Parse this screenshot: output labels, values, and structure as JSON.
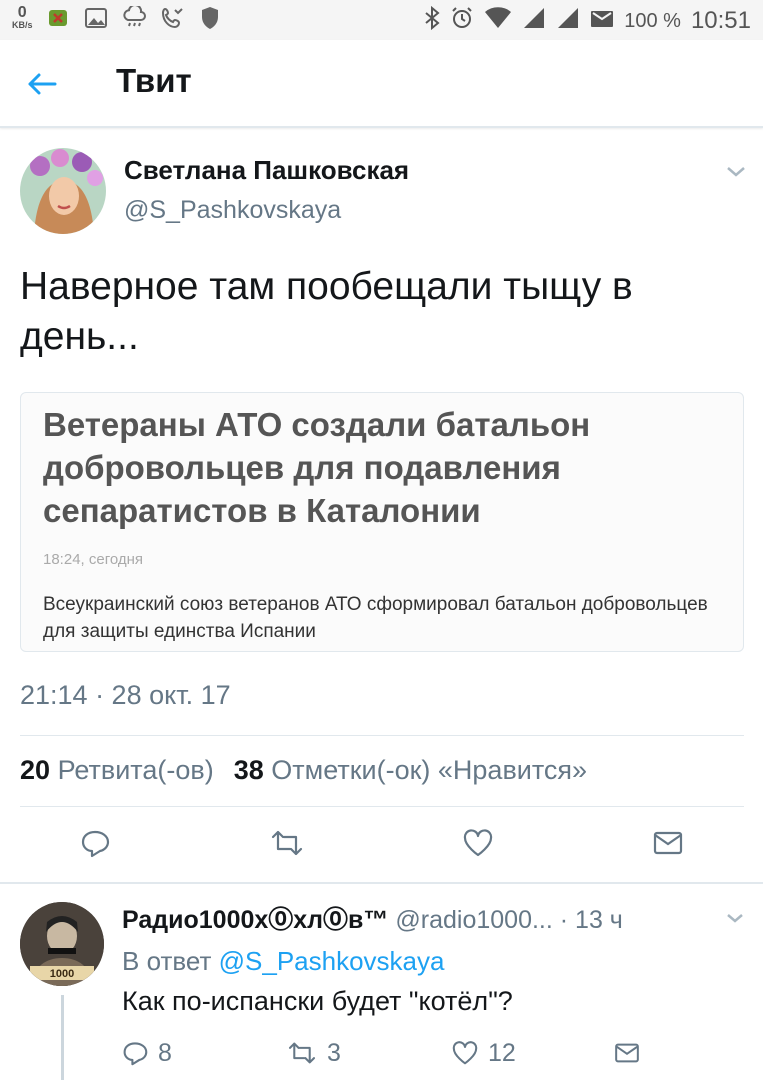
{
  "status_bar": {
    "net_speed": "0",
    "net_unit": "KB/s",
    "battery": "100 %",
    "time": "10:51"
  },
  "header": {
    "title": "Твит"
  },
  "tweet": {
    "author_name": "Светлана Пашковская",
    "author_handle": "@S_Pashkovskaya",
    "text": "Наверное там пообещали тыщу в день...",
    "card": {
      "headline": "Ветераны АТО создали батальон добровольцев для подавления сепаратистов в Каталонии",
      "time": "18:24, сегодня",
      "lead": "Всеукраинский союз ветеранов АТО сформировал батальон добровольцев для защиты единства Испании"
    },
    "timestamp": "21:14 · 28 окт. 17",
    "retweet_count": "20",
    "retweet_label": "Ретвита(-ов)",
    "like_count": "38",
    "like_label": "Отметки(-ок) «Нравится»"
  },
  "reply": {
    "author_name": "Радио1000х⓪хл⓪в™",
    "author_handle": "@radio1000...",
    "time": "· 13 ч",
    "in_reply_prefix": "В ответ",
    "in_reply_handle": "@S_Pashkovskaya",
    "text": "Как по-испански будет \"котёл\"?",
    "reply_count": "8",
    "retweet_count": "3",
    "like_count": "12"
  },
  "colors": {
    "accent": "#1da1f2",
    "muted": "#657786",
    "divider": "#e1e8ed"
  }
}
